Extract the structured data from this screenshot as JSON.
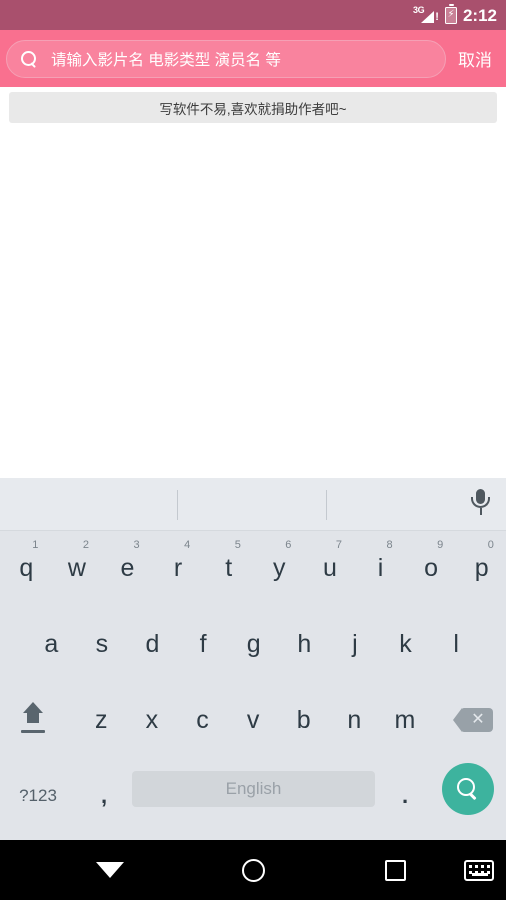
{
  "statusbar": {
    "network_label": "3G",
    "network_alert": "!",
    "battery_glyph": "⚡",
    "time": "2:12"
  },
  "appbar": {
    "search_icon": "search-icon",
    "search_value": "",
    "search_placeholder": "请输入影片名 电影类型 演员名 等",
    "cancel_label": "取消",
    "background_color": "#F9708F"
  },
  "banner": {
    "text": "写软件不易,喜欢就捐助作者吧~"
  },
  "keyboard": {
    "suggestion_strip": {
      "suggestions": [
        "",
        "",
        ""
      ],
      "mic_icon": "microphone-icon"
    },
    "row1": [
      {
        "key": "q",
        "num": "1"
      },
      {
        "key": "w",
        "num": "2"
      },
      {
        "key": "e",
        "num": "3"
      },
      {
        "key": "r",
        "num": "4"
      },
      {
        "key": "t",
        "num": "5"
      },
      {
        "key": "y",
        "num": "6"
      },
      {
        "key": "u",
        "num": "7"
      },
      {
        "key": "i",
        "num": "8"
      },
      {
        "key": "o",
        "num": "9"
      },
      {
        "key": "p",
        "num": "0"
      }
    ],
    "row2": [
      {
        "key": "a"
      },
      {
        "key": "s"
      },
      {
        "key": "d"
      },
      {
        "key": "f"
      },
      {
        "key": "g"
      },
      {
        "key": "h"
      },
      {
        "key": "j"
      },
      {
        "key": "k"
      },
      {
        "key": "l"
      }
    ],
    "row3": [
      {
        "key": "z"
      },
      {
        "key": "x"
      },
      {
        "key": "c"
      },
      {
        "key": "v"
      },
      {
        "key": "b"
      },
      {
        "key": "n"
      },
      {
        "key": "m"
      }
    ],
    "shift_label": "shift-key",
    "backspace_label": "backspace-key",
    "row4": {
      "symbols_label": "?123",
      "comma_label": ",",
      "space_label": "English",
      "period_label": ".",
      "enter_icon": "search-icon"
    },
    "accent_color": "#3DB39E",
    "background_color": "#E1E4E9"
  },
  "navbar": {
    "back_label": "back-button",
    "home_label": "home-button",
    "recents_label": "recents-button",
    "keyboard_label": "keyboard-switch-button"
  }
}
